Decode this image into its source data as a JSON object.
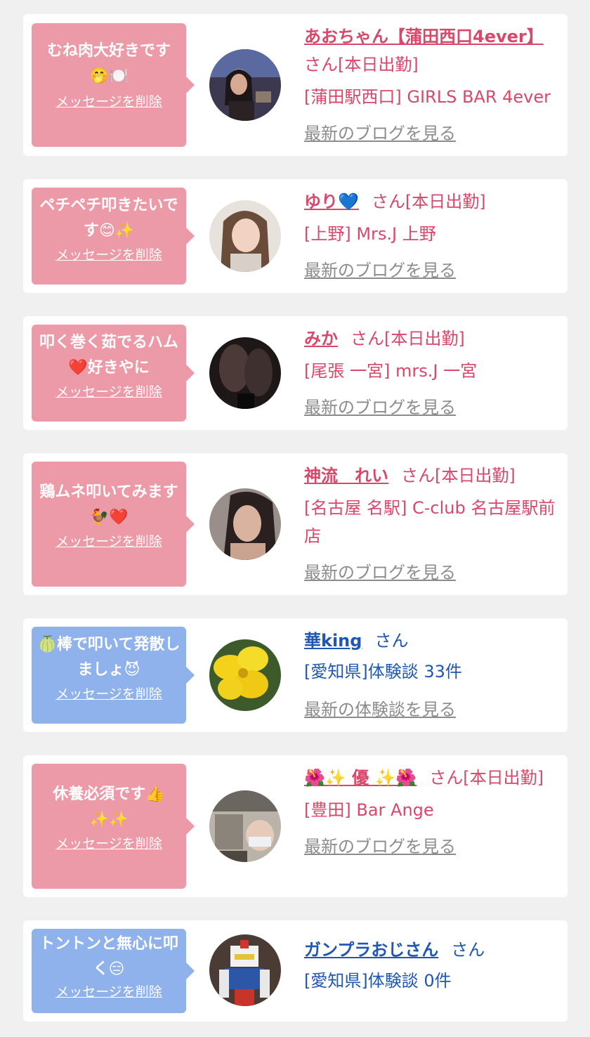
{
  "delete_label": "メッセージを削除",
  "cards": [
    {
      "message": "むね肉大好きです🤭🍽️",
      "name": "あおちゃん【蒲田西口4ever】",
      "honorific": "さん[本日出勤]",
      "location": "[蒲田駅西口] GIRLS BAR 4ever",
      "link": "最新のブログを見る"
    },
    {
      "message": "ペチペチ叩きたいです😊✨",
      "name": "ゆり💙",
      "honorific": "さん[本日出勤]",
      "location": "[上野] Mrs.J 上野",
      "link": "最新のブログを見る"
    },
    {
      "message": "叩く巻く茹でるハム❤️好きやに",
      "name": "みか",
      "honorific": "さん[本日出勤]",
      "location": "[尾張 一宮] mrs.J 一宮",
      "link": "最新のブログを見る"
    },
    {
      "message": "鶏ムネ叩いてみます🐓❤️",
      "name": "神流　れい",
      "honorific": "さん[本日出勤]",
      "location": "[名古屋 名駅] C-club 名古屋駅前店",
      "link": "最新のブログを見る"
    },
    {
      "message": "🍈棒で叩いて発散しましょ😈",
      "name": "華king",
      "honorific": "さん",
      "location": "[愛知県]体験談 33件",
      "link": "最新の体験談を見る"
    },
    {
      "message": "休養必須です👍✨✨",
      "name": "🌺✨ 優 ✨🌺",
      "honorific": "さん[本日出勤]",
      "location": "[豊田] Bar Ange",
      "link": "最新のブログを見る"
    },
    {
      "message": "トントンと無心に叩く😑",
      "name": "ガンプラおじさん",
      "honorific": "さん",
      "location": "[愛知県]体験談 0件",
      "link": ""
    }
  ],
  "colors": {
    "pink_bubble": "#ec9aa7",
    "blue_bubble": "#8fb1ec",
    "cast_name": "#d9486a",
    "user_name": "#1f57b3",
    "link_gray": "#8c8c8c",
    "background": "#f0f0f1"
  }
}
